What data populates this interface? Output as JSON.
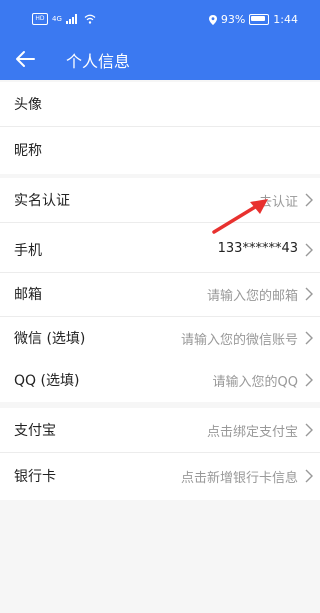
{
  "status": {
    "carrier_left": "HD",
    "network": "4G",
    "battery_pct": "93%",
    "time": "1:44"
  },
  "header": {
    "back_icon": "arrow-left-icon",
    "title": "个人信息"
  },
  "rows": [
    {
      "label": "头像"
    },
    {
      "label": "昵称"
    },
    {
      "label": "实名认证",
      "value": "去认证"
    },
    {
      "label": "手机",
      "value": "133******43"
    },
    {
      "label": "邮箱",
      "value": "请输入您的邮箱"
    },
    {
      "label": "微信 (选填)",
      "value": "请输入您的微信账号"
    },
    {
      "label": "QQ (选填)",
      "value": "请输入您的QQ"
    },
    {
      "label": "支付宝",
      "value": "点击绑定支付宝"
    },
    {
      "label": "银行卡",
      "value": "点击新增银行卡信息"
    }
  ],
  "colors": {
    "primary": "#3b79f1",
    "annotation": "#e8312f"
  }
}
